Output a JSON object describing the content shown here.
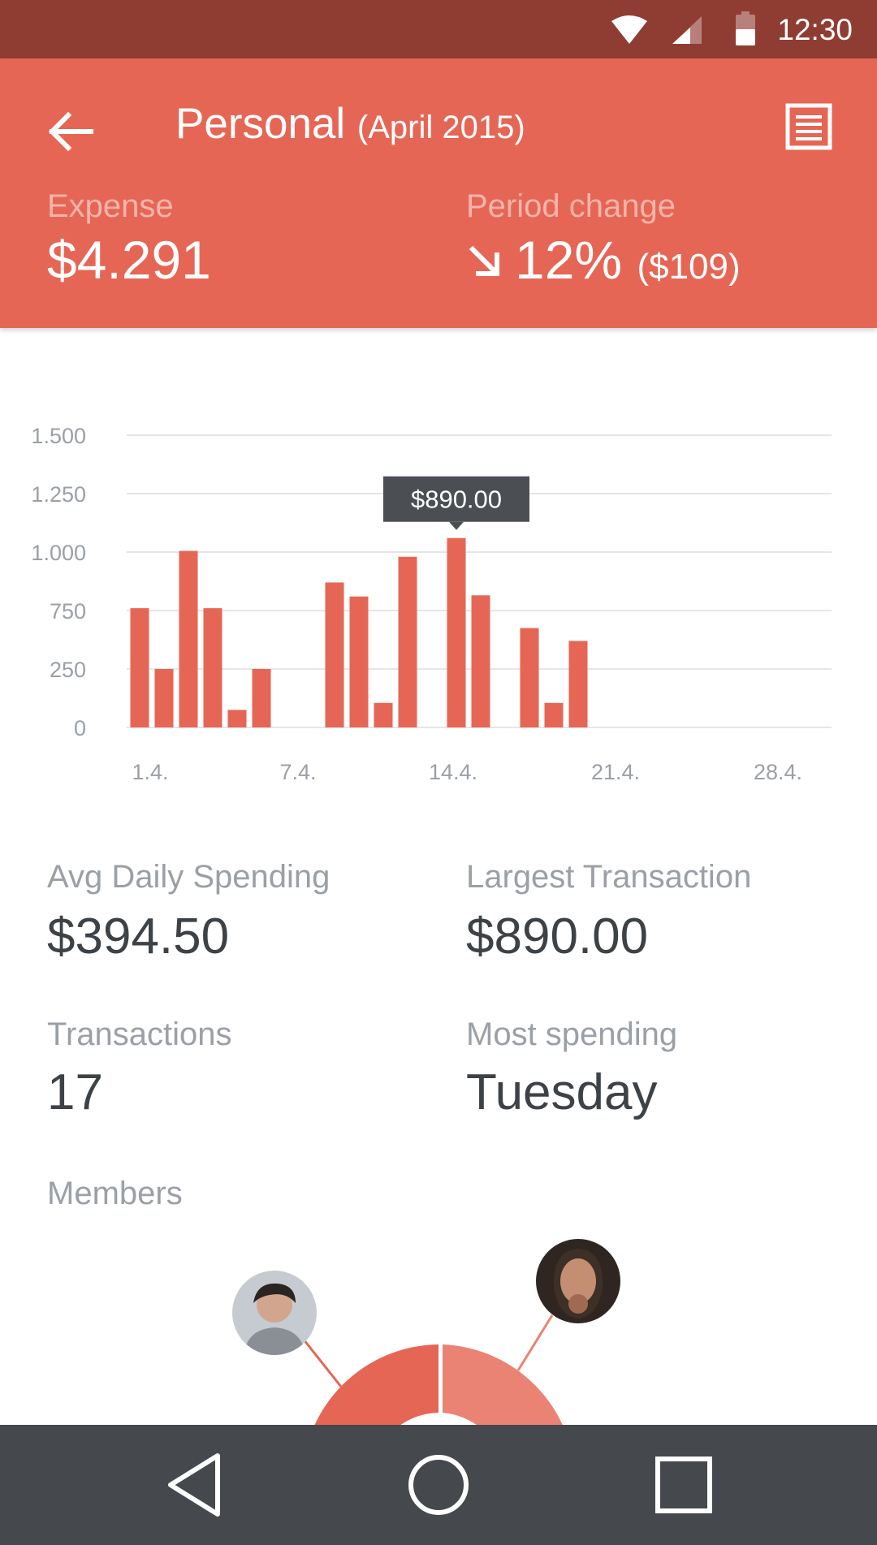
{
  "status_bar": {
    "time": "12:30"
  },
  "header": {
    "title": "Personal",
    "subtitle": "(April 2015)",
    "expense_label": "Expense",
    "expense_value": "$4.291",
    "period_label": "Period change",
    "period_value": "12%",
    "period_amount": "($109)"
  },
  "chart_data": {
    "type": "bar",
    "x_tick_labels": [
      "1.4.",
      "7.4.",
      "14.4.",
      "21.4.",
      "28.4."
    ],
    "y_tick_labels": [
      "0",
      "250",
      "750",
      "1.000",
      "1.250",
      "1.500"
    ],
    "ylim": [
      0,
      1500
    ],
    "grid": true,
    "days": [
      1,
      2,
      3,
      4,
      5,
      6,
      9,
      10,
      11,
      12,
      14,
      15,
      17,
      18,
      19
    ],
    "values": [
      510,
      250,
      755,
      510,
      75,
      250,
      620,
      560,
      105,
      730,
      810,
      565,
      425,
      105,
      370
    ],
    "tooltip": {
      "day": 14,
      "label": "$890.00"
    },
    "bar_color": "#e66655"
  },
  "stats": {
    "avg_daily_label": "Avg Daily Spending",
    "avg_daily_value": "$394.50",
    "largest_label": "Largest Transaction",
    "largest_value": "$890.00",
    "transactions_label": "Transactions",
    "transactions_value": "17",
    "most_spending_label": "Most spending",
    "most_spending_value": "Tuesday"
  },
  "members": {
    "label": "Members"
  },
  "colors": {
    "accent": "#e66655",
    "accent_dark": "#8f3d33",
    "accent_light": "#ea8373",
    "navbar": "#45484c"
  }
}
